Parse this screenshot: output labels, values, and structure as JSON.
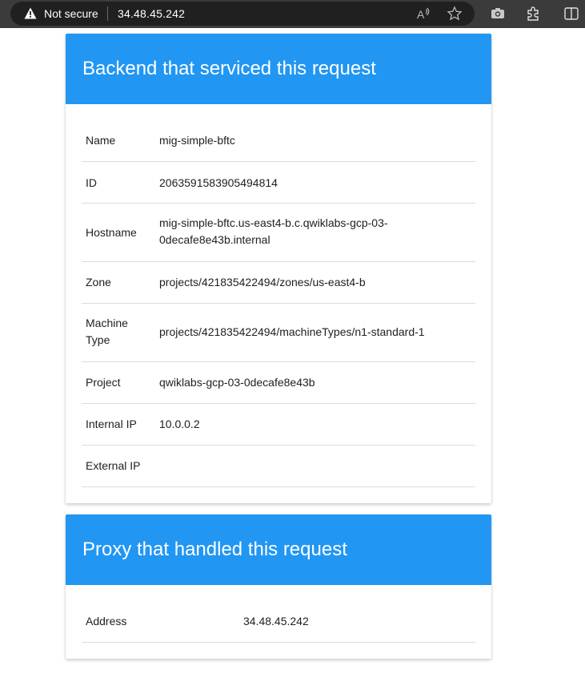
{
  "browser": {
    "security_label": "Not secure",
    "url": "34.48.45.242"
  },
  "backend": {
    "title": "Backend that serviced this request",
    "rows": [
      {
        "label": "Name",
        "value": "mig-simple-bftc"
      },
      {
        "label": "ID",
        "value": "2063591583905494814"
      },
      {
        "label": "Hostname",
        "value": "mig-simple-bftc.us-east4-b.c.qwiklabs-gcp-03-0decafe8e43b.internal"
      },
      {
        "label": "Zone",
        "value": "projects/421835422494/zones/us-east4-b"
      },
      {
        "label": "Machine Type",
        "value": "projects/421835422494/machineTypes/n1-standard-1"
      },
      {
        "label": "Project",
        "value": "qwiklabs-gcp-03-0decafe8e43b"
      },
      {
        "label": "Internal IP",
        "value": "10.0.0.2"
      },
      {
        "label": "External IP",
        "value": ""
      }
    ]
  },
  "proxy": {
    "title": "Proxy that handled this request",
    "rows": [
      {
        "label": "Address",
        "value": "34.48.45.242"
      }
    ]
  },
  "colors": {
    "header_blue": "#2196f3",
    "browser_bar": "#3b3b3b"
  }
}
